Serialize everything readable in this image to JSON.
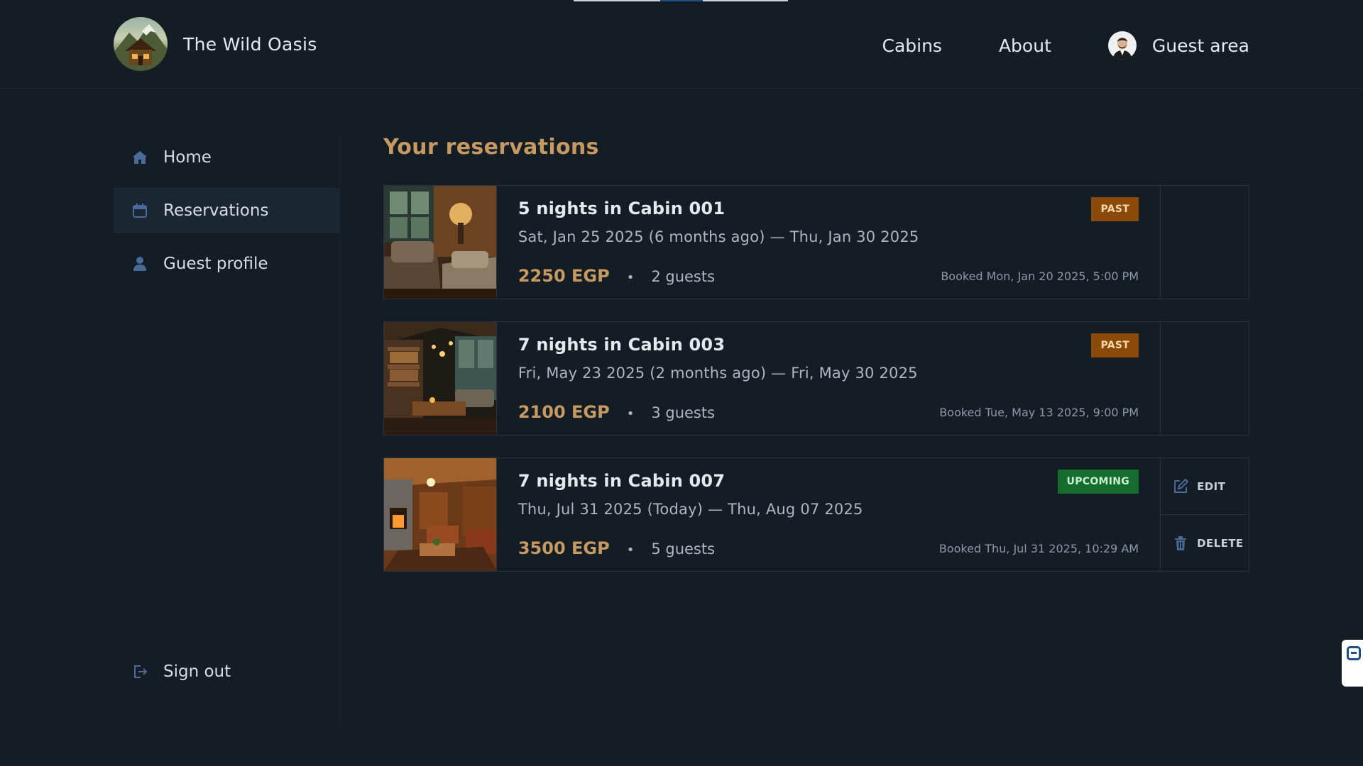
{
  "app": {
    "name": "The Wild Oasis"
  },
  "nav": {
    "cabins": "Cabins",
    "about": "About",
    "guest_area": "Guest area"
  },
  "sidebar": {
    "items": [
      {
        "label": "Home",
        "icon": "home-icon",
        "active": false
      },
      {
        "label": "Reservations",
        "icon": "calendar-icon",
        "active": true
      },
      {
        "label": "Guest profile",
        "icon": "user-icon",
        "active": false
      }
    ],
    "sign_out": "Sign out"
  },
  "page": {
    "title": "Your reservations"
  },
  "reservations": [
    {
      "title": "5 nights in Cabin 001",
      "dates": "Sat, Jan 25 2025 (6 months ago) — Thu, Jan 30 2025",
      "price": "2250 EGP",
      "separator": "•",
      "guests": "2 guests",
      "booked": "Booked Mon, Jan 20 2025, 5:00 PM",
      "status": "PAST"
    },
    {
      "title": "7 nights in Cabin 003",
      "dates": "Fri, May 23 2025 (2 months ago) — Fri, May 30 2025",
      "price": "2100 EGP",
      "separator": "•",
      "guests": "3 guests",
      "booked": "Booked Tue, May 13 2025, 9:00 PM",
      "status": "PAST"
    },
    {
      "title": "7 nights in Cabin 007",
      "dates": "Thu, Jul 31 2025 (Today) — Thu, Aug 07 2025",
      "price": "3500 EGP",
      "separator": "•",
      "guests": "5 guests",
      "booked": "Booked Thu, Jul 31 2025, 10:29 AM",
      "status": "UPCOMING",
      "actions": {
        "edit": "EDIT",
        "delete": "DELETE"
      }
    }
  ],
  "colors": {
    "background": "#141c24",
    "accent": "#c69963",
    "badge_past": "#8a4b0a",
    "badge_upcoming": "#146c2e"
  }
}
